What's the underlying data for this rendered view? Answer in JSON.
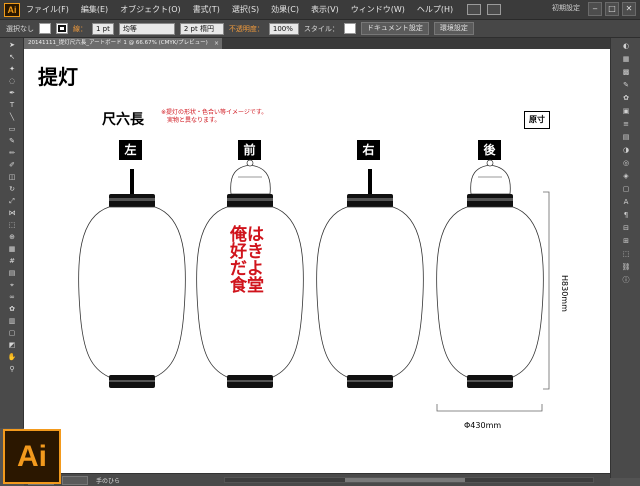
{
  "app": {
    "logo_text": "Ai",
    "menu": [
      "ファイル(F)",
      "編集(E)",
      "オブジェクト(O)",
      "書式(T)",
      "選択(S)",
      "効果(C)",
      "表示(V)",
      "ウィンドウ(W)",
      "ヘルプ(H)"
    ],
    "workspace": "初期設定",
    "window_buttons": [
      "‒",
      "□",
      "✕"
    ]
  },
  "control_bar": {
    "selection": "選択なし",
    "stroke_label": "線：",
    "stroke_value": "1 pt",
    "profile": "均等",
    "brush": "2 pt 楕円",
    "opacity_label": "不透明度：",
    "opacity_value": "100%",
    "style_label": "スタイル：",
    "doc_settings": "ドキュメント設定",
    "env_settings": "環境設定"
  },
  "document_tab": {
    "title": "20141111_提灯尺六長_アートボード 1 @ 66.67% (CMYK/プレビュー)",
    "close": "×"
  },
  "status_bar": {
    "tool_name": "手のひら"
  },
  "artwork": {
    "title": "提灯",
    "size": "尺六長",
    "note": "※提灯の形状・色合い等イメージです。\n　実物と異なります。",
    "scale_button": "原寸",
    "views": [
      "左",
      "前",
      "右",
      "後"
    ],
    "lantern_text": "俺は好きだよ食堂",
    "height_dim": "H830mm",
    "width_dim": "Φ430mm",
    "text_color": "#d0141c"
  },
  "big_logo": "Ai"
}
